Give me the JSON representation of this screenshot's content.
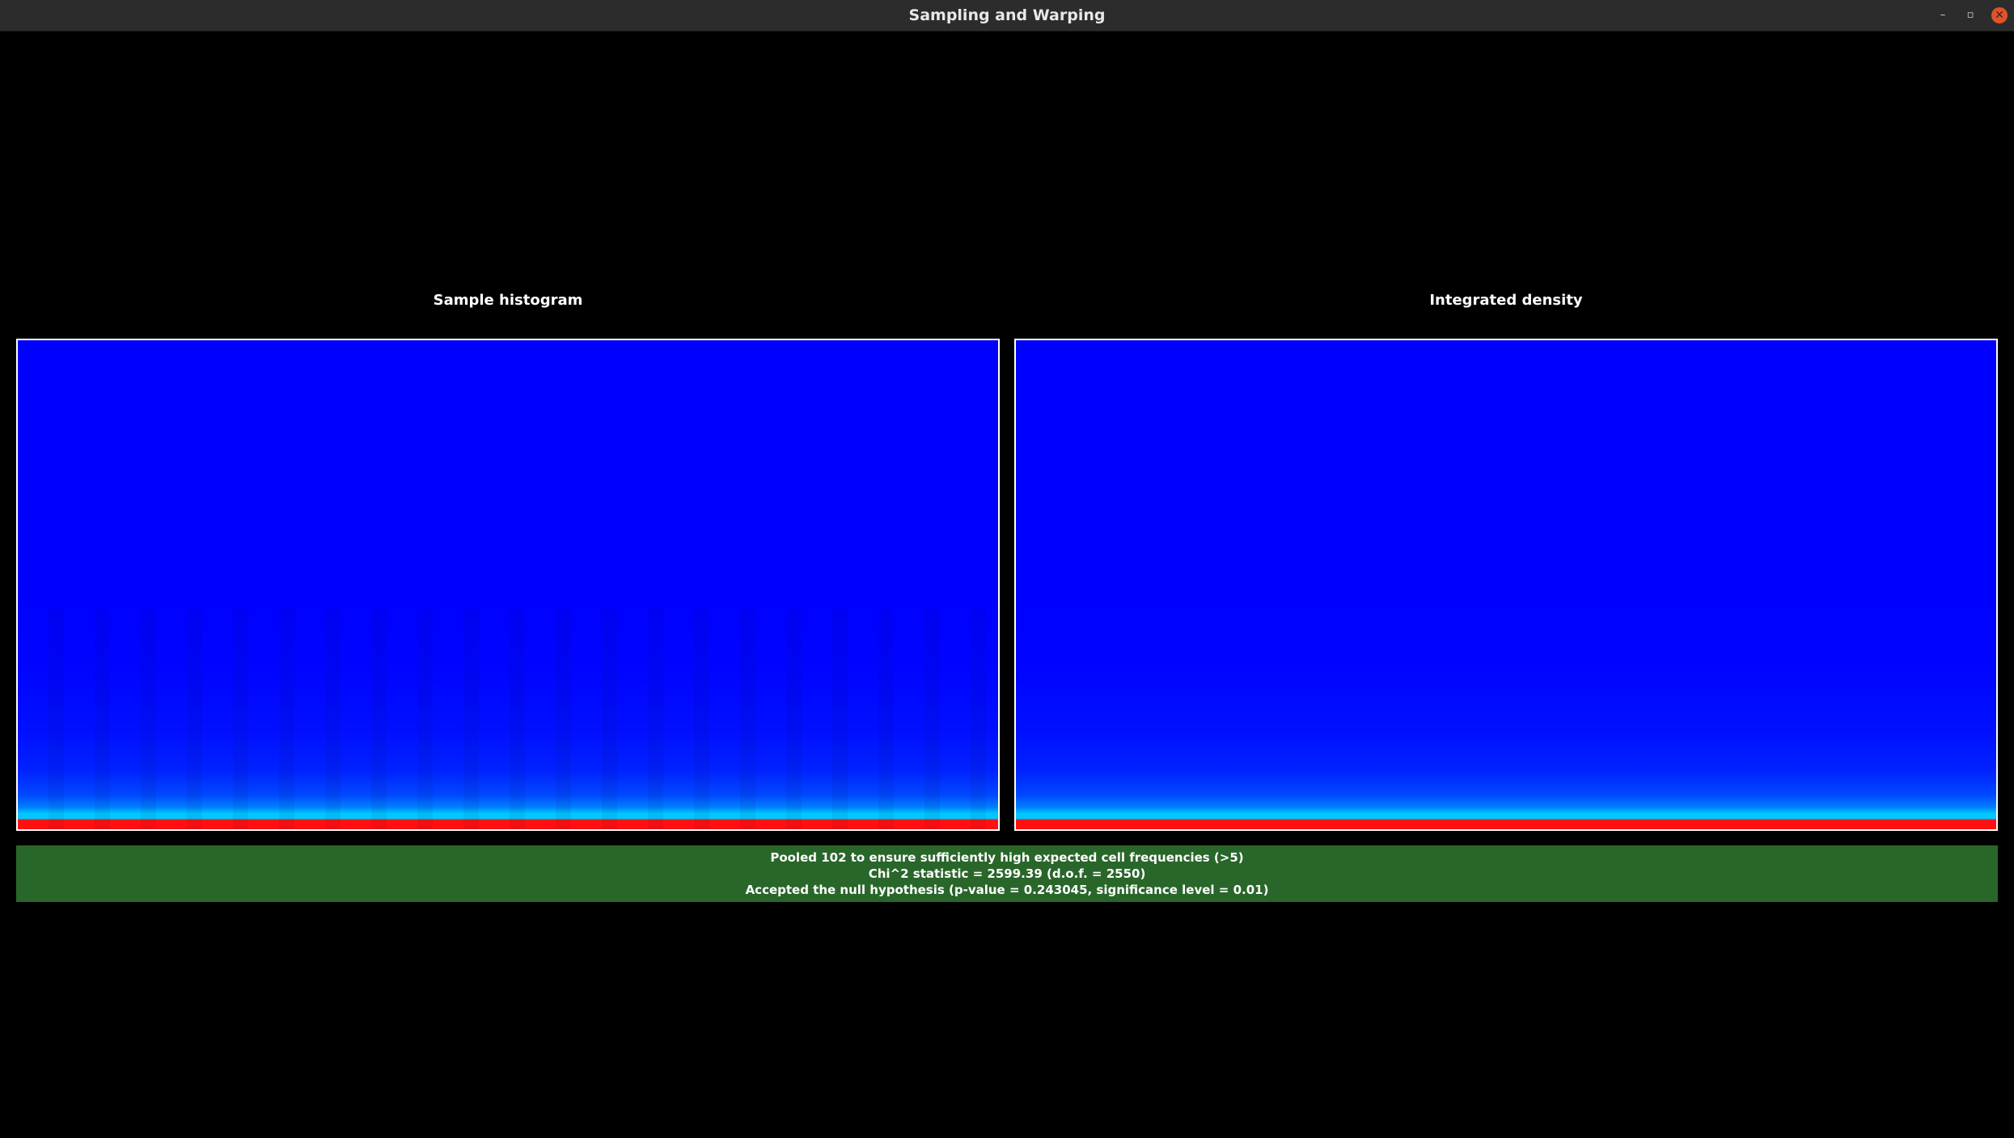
{
  "window": {
    "title": "Sampling and Warping",
    "controls": {
      "minimize": "–",
      "restore": "▫",
      "close": "✕"
    }
  },
  "panels": {
    "left": {
      "title": "Sample histogram"
    },
    "right": {
      "title": "Integrated density"
    }
  },
  "result": {
    "status": "accepted",
    "color": "#29662a",
    "lines": [
      "Pooled 102 to ensure sufficiently high expected cell frequencies (>5)",
      "Chi^2 statistic = 2599.39 (d.o.f. = 2550)",
      "Accepted the null hypothesis (p-value = 0.243045, significance level = 0.01)"
    ]
  },
  "colors": {
    "plot_base": "#0000ff",
    "plot_mid": "#00c8ff",
    "plot_peak": "#ff1010",
    "plot_border": "#ffffff",
    "background": "#000000"
  }
}
